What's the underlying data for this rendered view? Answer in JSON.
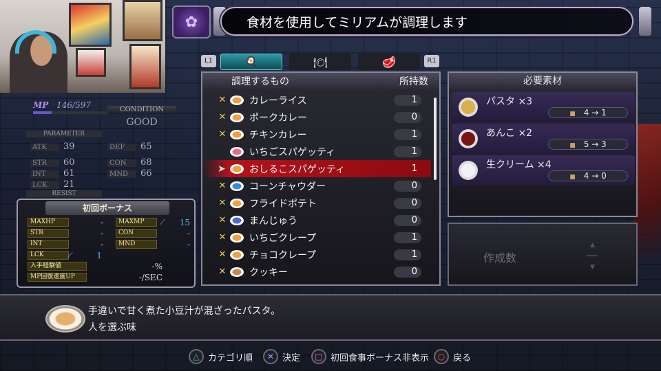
{
  "title": "食材を使用してミリアムが調理します",
  "stats": {
    "mp_label": "MP",
    "mp_value": "146/597",
    "mp_fraction": 0.245,
    "condition_label": "CONDITION",
    "condition_value": "GOOD",
    "parameter_label": "PARAMETER",
    "resist_label": "RESIST",
    "items": [
      {
        "key": "ATK",
        "value": "39"
      },
      {
        "key": "DEF",
        "value": "65"
      },
      {
        "key": "STR",
        "value": "60"
      },
      {
        "key": "CON",
        "value": "68"
      },
      {
        "key": "INT",
        "value": "61"
      },
      {
        "key": "MND",
        "value": "66"
      },
      {
        "key": "LCK",
        "value": "21"
      }
    ]
  },
  "bonus": {
    "title": "初回ボーナス",
    "rows": [
      {
        "key": "MAXHP",
        "value": "-"
      },
      {
        "key": "MAXMP",
        "value": "15"
      },
      {
        "key": "STR",
        "value": "-"
      },
      {
        "key": "CON",
        "value": "-"
      },
      {
        "key": "INT",
        "value": "-"
      },
      {
        "key": "MND",
        "value": "-"
      },
      {
        "key": "LCK",
        "value": "1"
      },
      {
        "key": "入手経験値",
        "value": "-%"
      },
      {
        "key": "MP回復速度UP",
        "value": "-/SEC"
      }
    ]
  },
  "tabs": {
    "left_button": "L1",
    "right_button": "R1",
    "items": [
      {
        "icon": "chef-icon",
        "active": true
      },
      {
        "icon": "plate-icon",
        "active": false
      },
      {
        "icon": "meat-icon",
        "active": false
      }
    ]
  },
  "list": {
    "header_name": "調理するもの",
    "header_count": "所持数",
    "items": [
      {
        "name": "カレーライス",
        "count": "1"
      },
      {
        "name": "ポークカレー",
        "count": "0"
      },
      {
        "name": "チキンカレー",
        "count": "1"
      },
      {
        "name": "いちごスパゲッティ",
        "count": "1"
      },
      {
        "name": "おしるこスパゲッティ",
        "count": "1"
      },
      {
        "name": "コーンチャウダー",
        "count": "0"
      },
      {
        "name": "フライドポテト",
        "count": "0"
      },
      {
        "name": "まんじゅう",
        "count": "0"
      },
      {
        "name": "いちごクレープ",
        "count": "1"
      },
      {
        "name": "チョコクレープ",
        "count": "1"
      },
      {
        "name": "クッキー",
        "count": "0"
      }
    ]
  },
  "materials": {
    "header": "必要素材",
    "items": [
      {
        "name": "パスタ ×3",
        "change": "4 → 1",
        "icon_color": "#d8b04a"
      },
      {
        "name": "あんこ ×2",
        "change": "5 → 3",
        "icon_color": "#7a1414"
      },
      {
        "name": "生クリーム ×4",
        "change": "4 → 0",
        "icon_color": "#f2f2f2"
      }
    ]
  },
  "quantity": {
    "label": "作成数",
    "value": "—"
  },
  "description": {
    "line1": "手違いで甘く煮た小豆汁が混ざったパスタ。",
    "line2": "人を選ぶ味"
  },
  "prompts": [
    {
      "icon": "triangle-icon",
      "glyph": "△",
      "label": "カテゴリ順"
    },
    {
      "icon": "cross-icon",
      "glyph": "✕",
      "label": "決定"
    },
    {
      "icon": "square-icon",
      "glyph": "□",
      "label": "初回食事ボーナス非表示"
    },
    {
      "icon": "circle-icon",
      "glyph": "○",
      "label": "戻る"
    }
  ]
}
